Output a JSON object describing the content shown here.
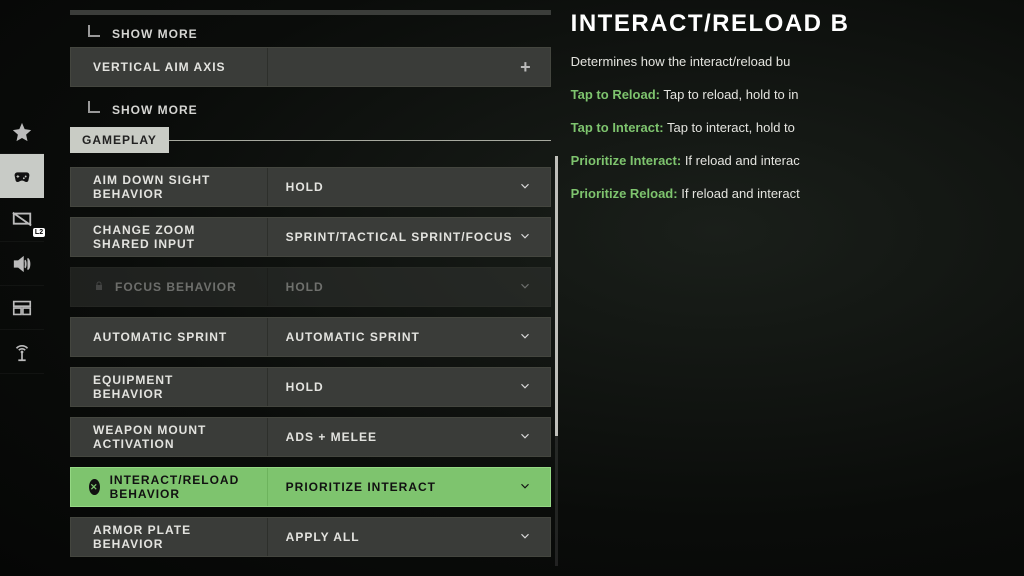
{
  "sidebar": {
    "badge": "L2"
  },
  "topbar": {
    "show_more": "SHOW MORE",
    "vertical_aim": "VERTICAL AIM AXIS"
  },
  "section": {
    "title": "GAMEPLAY"
  },
  "rows": [
    {
      "label": "AIM DOWN SIGHT BEHAVIOR",
      "value": "HOLD"
    },
    {
      "label": "CHANGE ZOOM SHARED INPUT",
      "value": "SPRINT/TACTICAL SPRINT/FOCUS"
    },
    {
      "label": "FOCUS BEHAVIOR",
      "value": "HOLD"
    },
    {
      "label": "AUTOMATIC SPRINT",
      "value": "AUTOMATIC SPRINT"
    },
    {
      "label": "EQUIPMENT BEHAVIOR",
      "value": "HOLD"
    },
    {
      "label": "WEAPON MOUNT ACTIVATION",
      "value": "ADS + MELEE"
    },
    {
      "label": "INTERACT/RELOAD BEHAVIOR",
      "value": "PRIORITIZE INTERACT"
    },
    {
      "label": "ARMOR PLATE BEHAVIOR",
      "value": "APPLY ALL"
    }
  ],
  "desc": {
    "title": "INTERACT/RELOAD B",
    "sub": "Determines how the interact/reload bu",
    "items": [
      {
        "key": "Tap to Reload:",
        "txt": " Tap to reload, hold to in"
      },
      {
        "key": "Tap to Interact:",
        "txt": " Tap to interact, hold to"
      },
      {
        "key": "Prioritize Interact:",
        "txt": " If reload and interac"
      },
      {
        "key": "Prioritize Reload:",
        "txt": " If reload and interact"
      }
    ]
  }
}
